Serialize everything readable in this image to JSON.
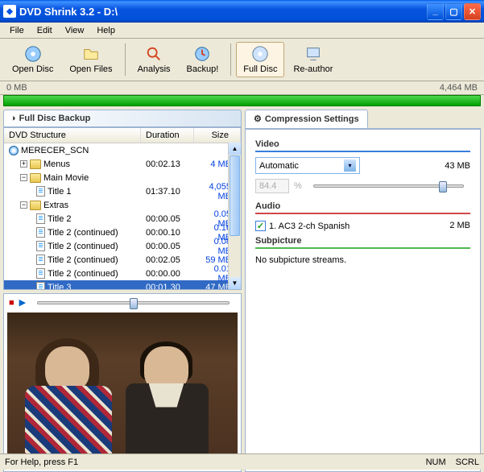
{
  "window": {
    "title": "DVD Shrink 3.2 - D:\\"
  },
  "menu": {
    "file": "File",
    "edit": "Edit",
    "view": "View",
    "help": "Help"
  },
  "toolbar": {
    "open_disc": "Open Disc",
    "open_files": "Open Files",
    "analysis": "Analysis",
    "backup": "Backup!",
    "full_disc": "Full Disc",
    "reauthor": "Re-author"
  },
  "sizebar": {
    "left": "0 MB",
    "right": "4,464 MB"
  },
  "left_panel": {
    "title": "Full Disc Backup"
  },
  "columns": {
    "name": "DVD Structure",
    "duration": "Duration",
    "size": "Size"
  },
  "tree": {
    "root": "MERECER_SCN",
    "menus": {
      "label": "Menus",
      "dur": "00:02.13",
      "size": "4 MB"
    },
    "main": {
      "label": "Main Movie",
      "t1": {
        "label": "Title 1",
        "dur": "01:37.10",
        "size": "4,055 MB"
      }
    },
    "extras": {
      "label": "Extras",
      "r1": {
        "label": "Title 2",
        "dur": "00:00.05",
        "size": "0.05 MB"
      },
      "r2": {
        "label": "Title 2 (continued)",
        "dur": "00:00.10",
        "size": "0.16 MB"
      },
      "r3": {
        "label": "Title 2 (continued)",
        "dur": "00:00.05",
        "size": "0.08 MB"
      },
      "r4": {
        "label": "Title 2 (continued)",
        "dur": "00:02.05",
        "size": "59 MB"
      },
      "r5": {
        "label": "Title 2 (continued)",
        "dur": "00:00.00",
        "size": "0.01 MB"
      },
      "r6": {
        "label": "Title 3",
        "dur": "00:01.30",
        "size": "47 MB"
      }
    }
  },
  "comp": {
    "tab": "Compression Settings",
    "video": {
      "head": "Video",
      "mode": "Automatic",
      "pct": "84.4",
      "pct_unit": "%",
      "size": "43 MB"
    },
    "audio": {
      "head": "Audio",
      "track1": "1. AC3 2-ch Spanish",
      "size1": "2 MB"
    },
    "sub": {
      "head": "Subpicture",
      "msg": "No subpicture streams."
    }
  },
  "status": {
    "help": "For Help, press F1",
    "num": "NUM",
    "scrl": "SCRL"
  }
}
